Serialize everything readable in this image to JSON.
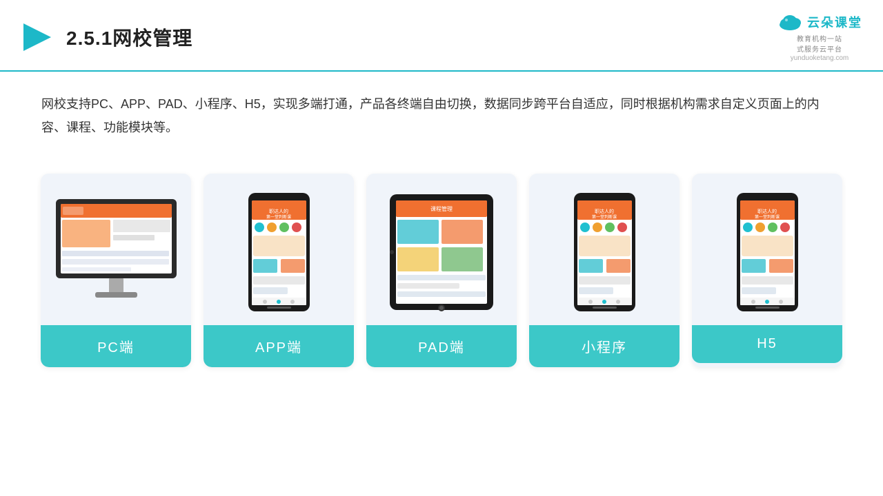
{
  "header": {
    "title": "2.5.1网校管理",
    "logo_main": "云朵课堂",
    "logo_url": "yunduoketang.com",
    "logo_sub": "教育机构一站\n式服务云平台"
  },
  "description": {
    "text": "网校支持PC、APP、PAD、小程序、H5，实现多端打通，产品各终端自由切换，数据同步跨平台自适应，同时根据机构需求自定义页面上的内容、课程、功能模块等。"
  },
  "cards": [
    {
      "id": "pc",
      "label": "PC端",
      "device": "pc"
    },
    {
      "id": "app",
      "label": "APP端",
      "device": "phone"
    },
    {
      "id": "pad",
      "label": "PAD端",
      "device": "pad"
    },
    {
      "id": "miniprogram",
      "label": "小程序",
      "device": "phone2"
    },
    {
      "id": "h5",
      "label": "H5",
      "device": "phone3"
    }
  ],
  "colors": {
    "accent": "#3cc8c8",
    "header_line": "#1db8c8",
    "card_bg": "#f0f4fa",
    "text_dark": "#222222",
    "text_body": "#333333"
  }
}
